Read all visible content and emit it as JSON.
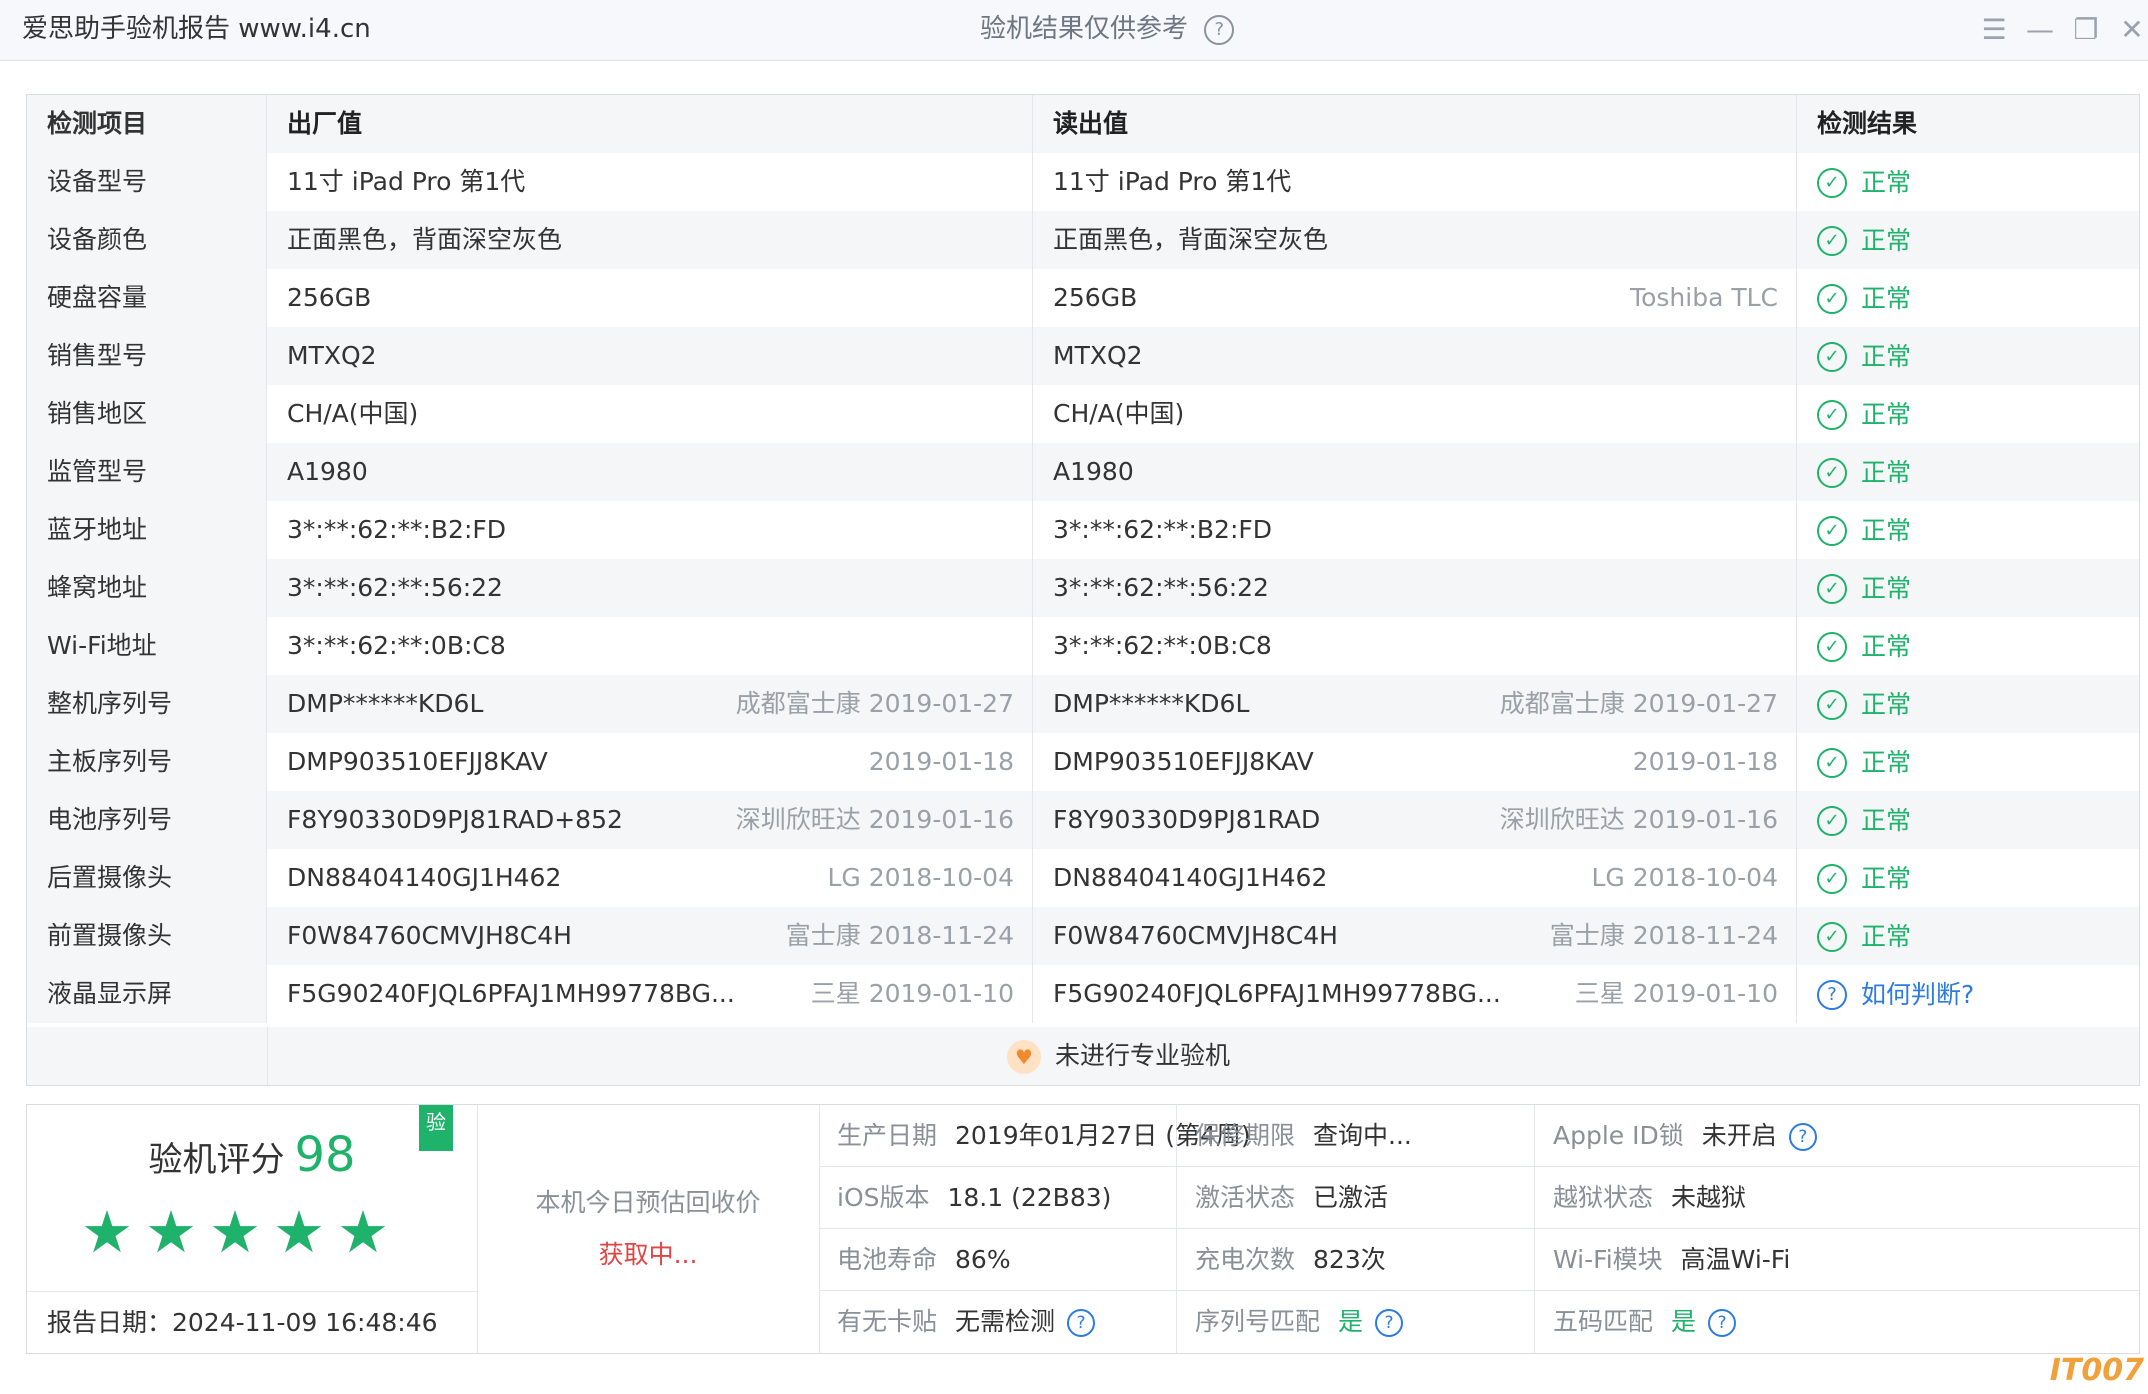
{
  "titlebar": {
    "app_title": "爱思助手验机报告 www.i4.cn",
    "center_title": "验机结果仅供参考"
  },
  "table": {
    "headers": [
      "检测项目",
      "出厂值",
      "读出值",
      "检测结果"
    ],
    "rows": [
      {
        "item": "设备型号",
        "factory": "11寸 iPad Pro 第1代",
        "factory_note": "",
        "read": "11寸 iPad Pro 第1代",
        "read_note": "",
        "result": "正常",
        "status": "ok"
      },
      {
        "item": "设备颜色",
        "factory": "正面黑色，背面深空灰色",
        "factory_note": "",
        "read": "正面黑色，背面深空灰色",
        "read_note": "",
        "result": "正常",
        "status": "ok"
      },
      {
        "item": "硬盘容量",
        "factory": "256GB",
        "factory_note": "",
        "read": "256GB",
        "read_note": "Toshiba TLC",
        "result": "正常",
        "status": "ok"
      },
      {
        "item": "销售型号",
        "factory": "MTXQ2",
        "factory_note": "",
        "read": "MTXQ2",
        "read_note": "",
        "result": "正常",
        "status": "ok"
      },
      {
        "item": "销售地区",
        "factory": "CH/A(中国)",
        "factory_note": "",
        "read": "CH/A(中国)",
        "read_note": "",
        "result": "正常",
        "status": "ok"
      },
      {
        "item": "监管型号",
        "factory": "A1980",
        "factory_note": "",
        "read": "A1980",
        "read_note": "",
        "result": "正常",
        "status": "ok"
      },
      {
        "item": "蓝牙地址",
        "factory": "3*:**:62:**:B2:FD",
        "factory_note": "",
        "read": "3*:**:62:**:B2:FD",
        "read_note": "",
        "result": "正常",
        "status": "ok"
      },
      {
        "item": "蜂窝地址",
        "factory": "3*:**:62:**:56:22",
        "factory_note": "",
        "read": "3*:**:62:**:56:22",
        "read_note": "",
        "result": "正常",
        "status": "ok"
      },
      {
        "item": "Wi-Fi地址",
        "factory": "3*:**:62:**:0B:C8",
        "factory_note": "",
        "read": "3*:**:62:**:0B:C8",
        "read_note": "",
        "result": "正常",
        "status": "ok"
      },
      {
        "item": "整机序列号",
        "factory": "DMP******KD6L",
        "factory_note": "成都富士康 2019-01-27",
        "read": "DMP******KD6L",
        "read_note": "成都富士康 2019-01-27",
        "result": "正常",
        "status": "ok"
      },
      {
        "item": "主板序列号",
        "factory": "DMP903510EFJJ8KAV",
        "factory_note": "2019-01-18",
        "read": "DMP903510EFJJ8KAV",
        "read_note": "2019-01-18",
        "result": "正常",
        "status": "ok"
      },
      {
        "item": "电池序列号",
        "factory": "F8Y90330D9PJ81RAD+852",
        "factory_note": "深圳欣旺达 2019-01-16",
        "read": "F8Y90330D9PJ81RAD",
        "read_note": "深圳欣旺达 2019-01-16",
        "result": "正常",
        "status": "ok"
      },
      {
        "item": "后置摄像头",
        "factory": "DN88404140GJ1H462",
        "factory_note": "LG 2018-10-04",
        "read": "DN88404140GJ1H462",
        "read_note": "LG 2018-10-04",
        "result": "正常",
        "status": "ok"
      },
      {
        "item": "前置摄像头",
        "factory": "F0W84760CMVJH8C4H",
        "factory_note": "富士康 2018-11-24",
        "read": "F0W84760CMVJH8C4H",
        "read_note": "富士康 2018-11-24",
        "result": "正常",
        "status": "ok"
      },
      {
        "item": "液晶显示屏",
        "factory": "F5G90240FJQL6PFAJ1MH99778BG...",
        "factory_note": "三星 2019-01-10",
        "read": "F5G90240FJQL6PFAJ1MH99778BG...",
        "read_note": "三星 2019-01-10",
        "result": "如何判断?",
        "status": "question"
      }
    ],
    "footer": "未进行专业验机"
  },
  "summary": {
    "score_label": "验机评分",
    "score": "98",
    "stars": 5,
    "badge": "验",
    "report_date": "报告日期：2024-11-09 16:48:46",
    "price_label": "本机今日预估回收价",
    "price_value": "获取中...",
    "grid": [
      [
        {
          "label": "生产日期",
          "value": "2019年01月27日 (第4周)",
          "help": false,
          "green": false
        },
        {
          "label": "保修期限",
          "value": "查询中...",
          "help": false,
          "green": false
        },
        {
          "label": "Apple ID锁",
          "value": "未开启",
          "help": true,
          "green": false
        }
      ],
      [
        {
          "label": "iOS版本",
          "value": "18.1 (22B83)",
          "help": false,
          "green": false
        },
        {
          "label": "激活状态",
          "value": "已激活",
          "help": false,
          "green": false
        },
        {
          "label": "越狱状态",
          "value": "未越狱",
          "help": false,
          "green": false
        }
      ],
      [
        {
          "label": "电池寿命",
          "value": "86%",
          "help": false,
          "green": false
        },
        {
          "label": "充电次数",
          "value": "823次",
          "help": false,
          "green": false
        },
        {
          "label": "Wi-Fi模块",
          "value": "高温Wi-Fi",
          "help": false,
          "green": false
        }
      ],
      [
        {
          "label": "有无卡贴",
          "value": "无需检测",
          "help": true,
          "green": false
        },
        {
          "label": "序列号匹配",
          "value": "是",
          "help": true,
          "green": true
        },
        {
          "label": "五码匹配",
          "value": "是",
          "help": true,
          "green": true
        }
      ]
    ]
  },
  "watermark": "IT007",
  "colors": {
    "ok": "#1fb26b",
    "link": "#2d7be0",
    "price": "#e04545"
  }
}
